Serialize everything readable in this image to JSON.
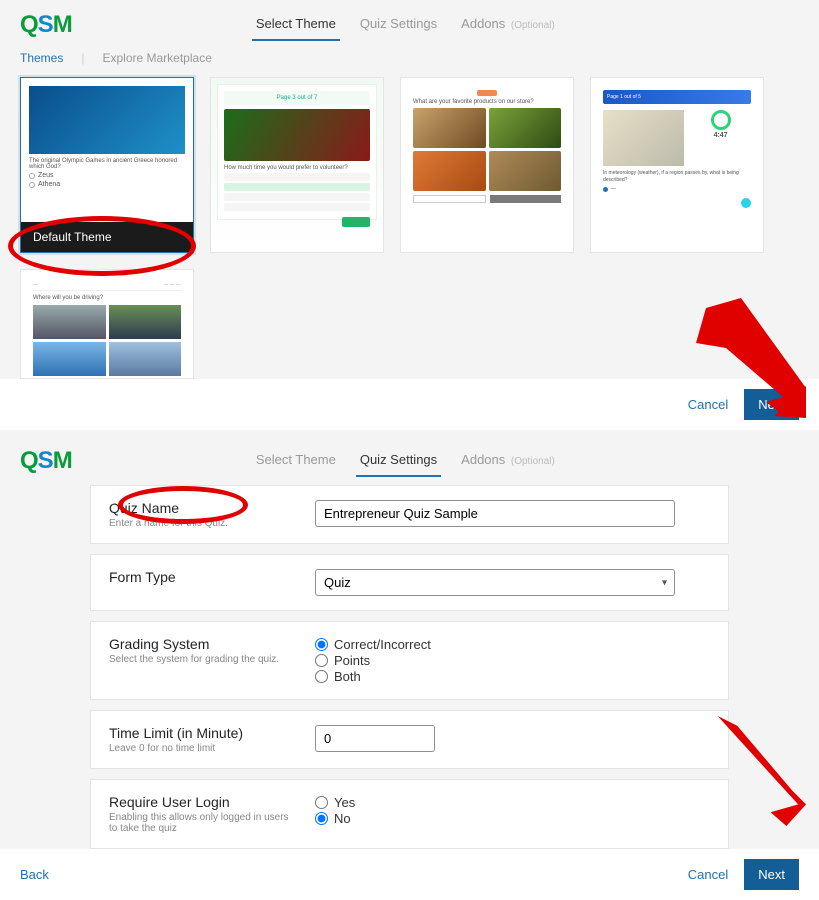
{
  "logo": "QSM",
  "panel1": {
    "tabs": {
      "select_theme": "Select Theme",
      "quiz_settings": "Quiz Settings",
      "addons": "Addons",
      "addons_opt": "(Optional)"
    },
    "subtabs": {
      "themes": "Themes",
      "explore": "Explore Marketplace"
    },
    "default_theme_caption": "Default Theme",
    "card1_question": "The original Olympic Games in ancient Greece honored which God?",
    "card1_opts": [
      "Zeus",
      "Athena"
    ],
    "card2_page": "Page 3 out of 7",
    "card2_question": "How much time you would prefer to volunteer?",
    "card3_question": "What are your favorite products on our store?",
    "card4_page": "Page 1 out of 5",
    "card4_timer": "4:47",
    "card4_question": "In meteorology (weather), if a region passes by, what is being described?",
    "card5_title": "Where will you be driving?",
    "footer": {
      "cancel": "Cancel",
      "next": "Next"
    }
  },
  "panel2": {
    "tabs": {
      "select_theme": "Select Theme",
      "quiz_settings": "Quiz Settings",
      "addons": "Addons",
      "addons_opt": "(Optional)"
    },
    "rows": {
      "quiz_name": {
        "label": "Quiz Name",
        "hint": "Enter a name for this Quiz.",
        "value": "Entrepreneur Quiz Sample"
      },
      "form_type": {
        "label": "Form Type",
        "value": "Quiz"
      },
      "grading": {
        "label": "Grading System",
        "hint": "Select the system for grading the quiz.",
        "opts": [
          "Correct/Incorrect",
          "Points",
          "Both"
        ],
        "selected": "Correct/Incorrect"
      },
      "time_limit": {
        "label": "Time Limit (in Minute)",
        "hint": "Leave 0 for no time limit",
        "value": "0"
      },
      "login": {
        "label": "Require User Login",
        "hint": "Enabling this allows only logged in users to take the quiz",
        "opts": [
          "Yes",
          "No"
        ],
        "selected": "No"
      }
    },
    "footer": {
      "back": "Back",
      "cancel": "Cancel",
      "next": "Next"
    }
  }
}
